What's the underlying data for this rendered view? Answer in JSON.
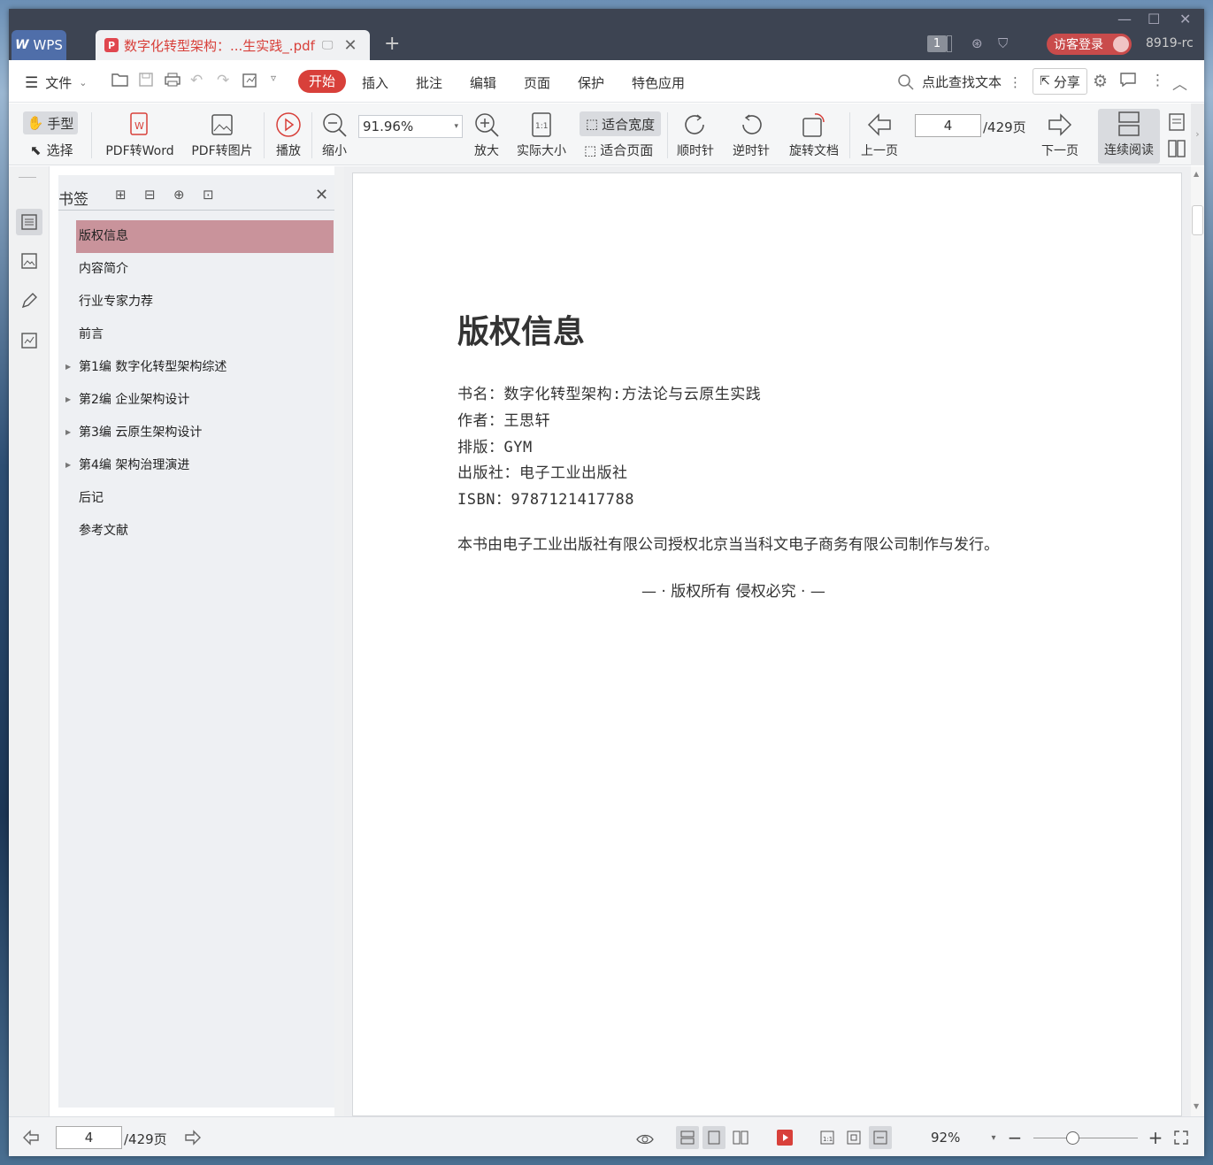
{
  "titlebar": {
    "app_tab": "WPS",
    "doc_tab_title": "数字化转型架构：...生实践_.pdf",
    "badge_count": "1",
    "guest_login": "访客登录",
    "user": "8919-rc"
  },
  "menu": {
    "file": "文件",
    "tabs": [
      "开始",
      "插入",
      "批注",
      "编辑",
      "页面",
      "保护",
      "特色应用"
    ],
    "search_placeholder": "点此查找文本",
    "share": "分享"
  },
  "toolbar": {
    "hand": "手型",
    "select": "选择",
    "pdf_to_word": "PDF转Word",
    "pdf_to_image": "PDF转图片",
    "play": "播放",
    "zoom_out": "缩小",
    "zoom_value": "91.96%",
    "zoom_in": "放大",
    "actual_size": "实际大小",
    "fit_width": "适合宽度",
    "fit_page": "适合页面",
    "clockwise": "顺时针",
    "counterclockwise": "逆时针",
    "rotate_doc": "旋转文档",
    "prev_page": "上一页",
    "current_page": "4",
    "page_total": "/429页",
    "next_page": "下一页",
    "continuous_read": "连续阅读"
  },
  "bookmarks": {
    "title": "书签",
    "items": [
      {
        "label": "版权信息",
        "expandable": false,
        "selected": true
      },
      {
        "label": "内容简介",
        "expandable": false,
        "selected": false
      },
      {
        "label": "行业专家力荐",
        "expandable": false,
        "selected": false
      },
      {
        "label": "前言",
        "expandable": false,
        "selected": false
      },
      {
        "label": "第1编 数字化转型架构综述",
        "expandable": true,
        "selected": false
      },
      {
        "label": "第2编 企业架构设计",
        "expandable": true,
        "selected": false
      },
      {
        "label": "第3编 云原生架构设计",
        "expandable": true,
        "selected": false
      },
      {
        "label": "第4编 架构治理演进",
        "expandable": true,
        "selected": false
      },
      {
        "label": "后记",
        "expandable": false,
        "selected": false
      },
      {
        "label": "参考文献",
        "expandable": false,
        "selected": false
      }
    ]
  },
  "document": {
    "heading": "版权信息",
    "lines": [
      "书名：数字化转型架构:方法论与云原生实践",
      "作者：王思轩",
      "排版：GYM",
      "出版社：电子工业出版社",
      "ISBN：9787121417788"
    ],
    "paragraph": "本书由电子工业出版社有限公司授权北京当当科文电子商务有限公司制作与发行。",
    "footer": "— · 版权所有 侵权必究 · —"
  },
  "statusbar": {
    "current_page": "4",
    "page_total": "/429页",
    "zoom": "92%",
    "slider_fraction": 0.37
  },
  "colors": {
    "accent": "#d8403a",
    "titlebar_bg": "#3d4452",
    "bookmark_selected": "#c9939b"
  }
}
